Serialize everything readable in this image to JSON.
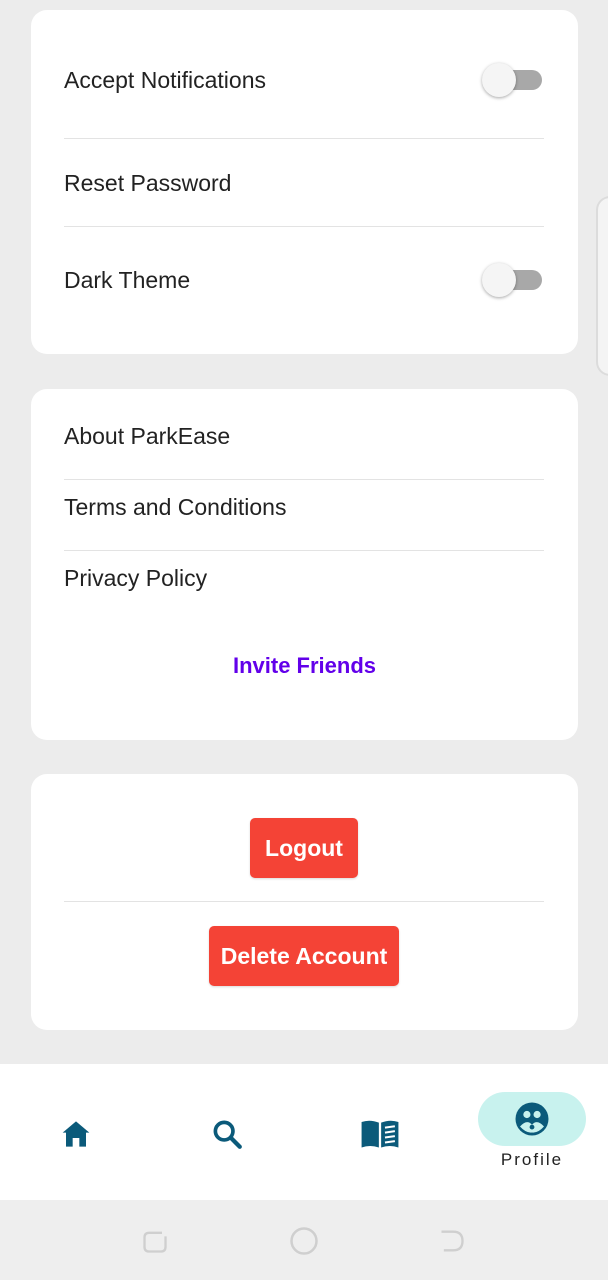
{
  "settings": {
    "accept_notifications": {
      "label": "Accept Notifications",
      "enabled": false
    },
    "reset_password": {
      "label": "Reset Password"
    },
    "dark_theme": {
      "label": "Dark Theme",
      "enabled": false
    }
  },
  "info": {
    "about": "About ParkEase",
    "terms": "Terms and Conditions",
    "privacy": "Privacy Policy",
    "invite": "Invite Friends"
  },
  "account": {
    "logout": "Logout",
    "delete": "Delete Account"
  },
  "bottom_nav": {
    "items": [
      {
        "icon": "home-icon"
      },
      {
        "icon": "search-icon"
      },
      {
        "icon": "book-icon"
      },
      {
        "icon": "profile-icon",
        "label": "Profile",
        "active": true
      }
    ]
  },
  "colors": {
    "accent_purple": "#6200ea",
    "danger_red": "#f44336",
    "nav_icon_blue": "#0b5a7a",
    "active_pill": "#c8f2ee",
    "background": "#ececec"
  }
}
